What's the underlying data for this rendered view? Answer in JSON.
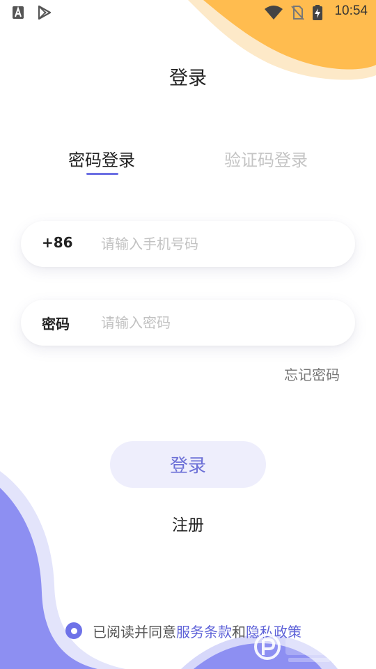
{
  "status_bar": {
    "time": "10:54"
  },
  "title": "登录",
  "tabs": [
    {
      "label": "密码登录",
      "active": true
    },
    {
      "label": "验证码登录",
      "active": false
    }
  ],
  "phone_field": {
    "prefix": "+86",
    "placeholder": "请输入手机号码",
    "value": ""
  },
  "password_field": {
    "label": "密码",
    "placeholder": "请输入密码",
    "value": ""
  },
  "forgot_password": "忘记密码",
  "login_button": "登录",
  "register": "注册",
  "agreement": {
    "checked": true,
    "text_prefix": "已阅读并同意",
    "terms_link": "服务条款",
    "conjunction": "和",
    "privacy_link": "隐私政策"
  },
  "colors": {
    "accent": "#6b6fe3",
    "orange": "#ffbc4f",
    "purple_wave": "#8d8ff2",
    "button_bg": "#eeeefc"
  }
}
